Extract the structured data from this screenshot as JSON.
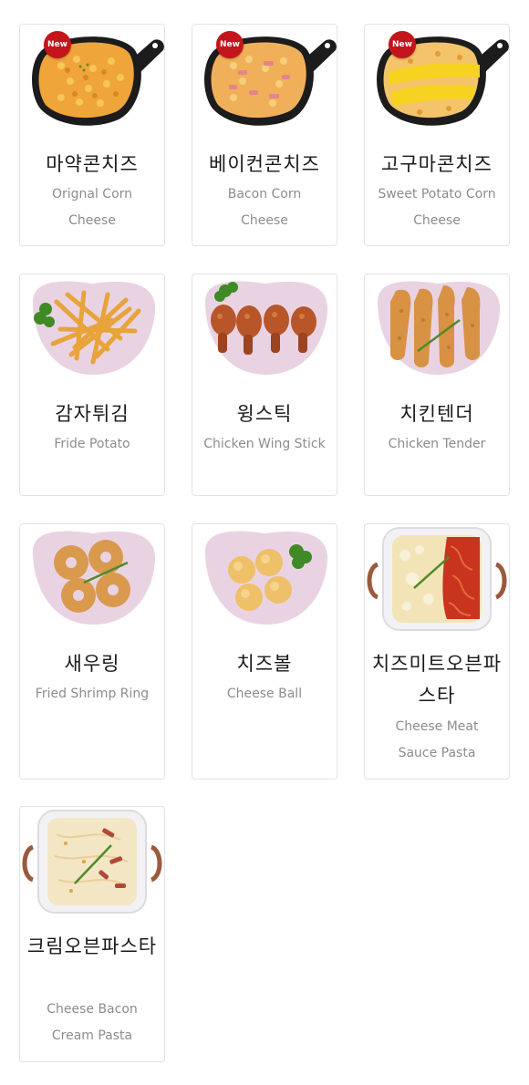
{
  "colors": {
    "badge": "#c4151c",
    "plate_pink": "#e9d3e3",
    "skillet": "#1c1c1c",
    "card_border": "#e3e3e3",
    "korean_text": "#1a1a1a",
    "english_text": "#8c8c8c"
  },
  "menu": [
    {
      "name_ko": "마약콘치즈",
      "name_en": "Orignal Corn Cheese",
      "badge": "New",
      "dish": "skillet-corn-cheese"
    },
    {
      "name_ko": "베이컨콘치즈",
      "name_en": "Bacon Corn Cheese",
      "badge": "New",
      "dish": "skillet-bacon-corn-cheese"
    },
    {
      "name_ko": "고구마콘치즈",
      "name_en": "Sweet Potato Corn Cheese",
      "badge": "New",
      "dish": "skillet-sweet-potato-corn-cheese"
    },
    {
      "name_ko": "감자튀김",
      "name_en": "Fride Potato",
      "dish": "pink-plate-fries"
    },
    {
      "name_ko": "윙스틱",
      "name_en": "Chicken Wing Stick",
      "dish": "pink-plate-wings"
    },
    {
      "name_ko": "치킨텐더",
      "name_en": "Chicken Tender",
      "dish": "pink-plate-tenders"
    },
    {
      "name_ko": "새우링",
      "name_en": "Fried Shrimp Ring",
      "dish": "pink-plate-shrimp-rings"
    },
    {
      "name_ko": "치즈볼",
      "name_en": "Cheese Ball",
      "dish": "pink-plate-cheese-balls"
    },
    {
      "name_ko": "치즈미트오븐파스타",
      "name_en": "Cheese Meat Sauce Pasta",
      "dish": "oven-dish-meat-pasta"
    },
    {
      "name_ko": "크림오븐파스타",
      "name_en": "Cheese Bacon Cream Pasta",
      "dish": "oven-dish-cream-pasta"
    }
  ]
}
